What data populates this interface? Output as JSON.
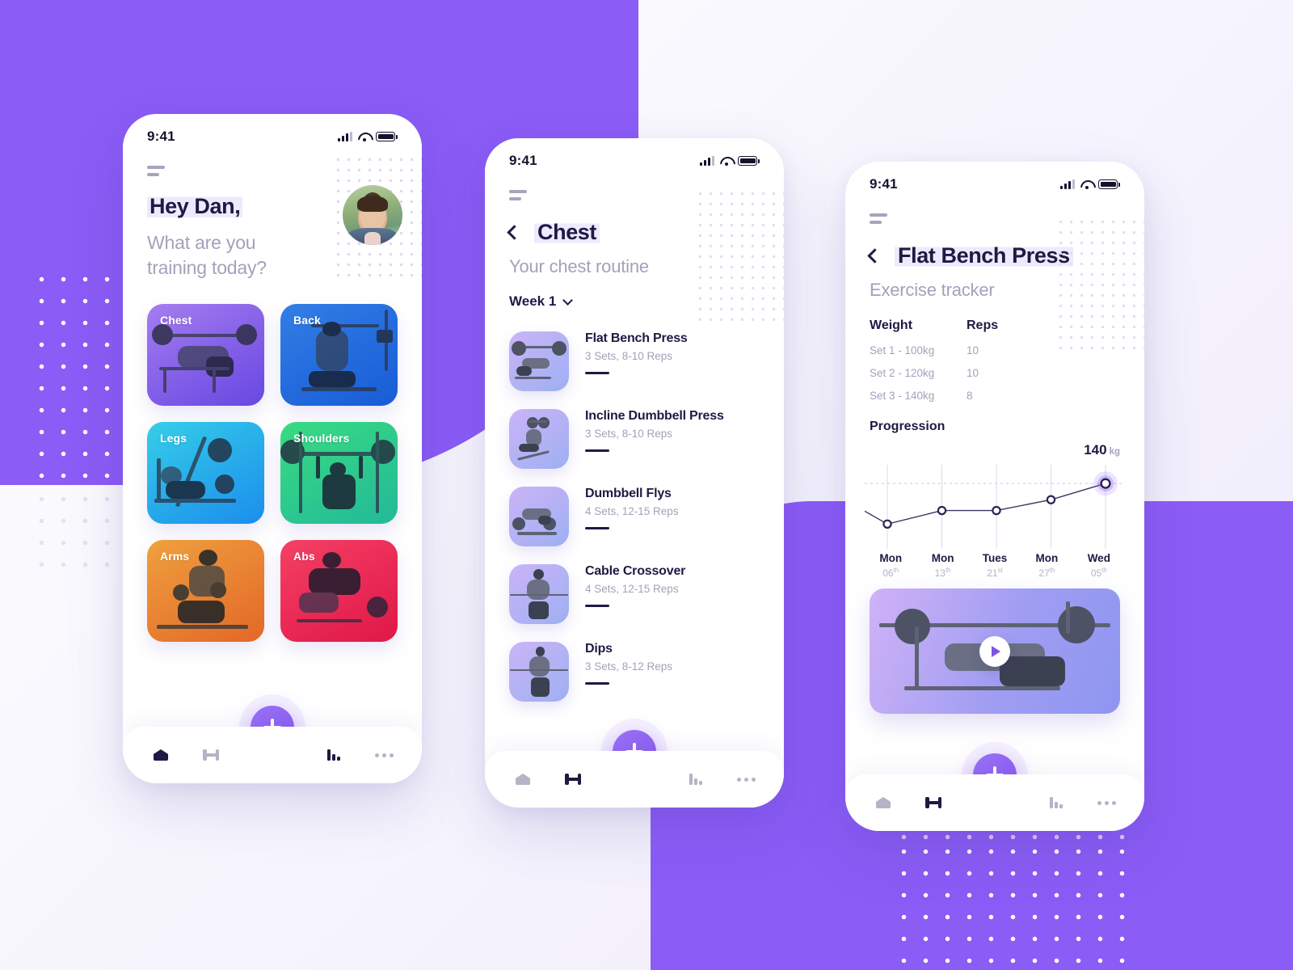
{
  "theme": {
    "accent": "#8b5cf6",
    "ink": "#1d1a43",
    "muted": "#a3a1bb"
  },
  "status_bar": {
    "time": "9:41"
  },
  "home": {
    "greeting": "Hey Dan,",
    "subtitle": "What are you\ntraining today?",
    "categories": [
      {
        "label": "Chest",
        "color_from": "#c6a7f5",
        "color_to": "#9b7ef0"
      },
      {
        "label": "Back",
        "color_from": "#5ea8f0",
        "color_to": "#3f8fe8"
      },
      {
        "label": "Legs",
        "color_from": "#5fe0f0",
        "color_to": "#44b8f5"
      },
      {
        "label": "Shoulders",
        "color_from": "#63e6a8",
        "color_to": "#4fd6c0"
      },
      {
        "label": "Arms",
        "color_from": "#f5c06a",
        "color_to": "#f09a55"
      },
      {
        "label": "Abs",
        "color_from": "#f96a8f",
        "color_to": "#ee3f7c"
      }
    ]
  },
  "routine": {
    "title": "Chest",
    "subtitle": "Your chest routine",
    "week_label": "Week 1",
    "exercises": [
      {
        "name": "Flat Bench Press",
        "meta": "3 Sets, 8-10 Reps"
      },
      {
        "name": "Incline Dumbbell Press",
        "meta": "3 Sets, 8-10 Reps"
      },
      {
        "name": "Dumbbell Flys",
        "meta": "4 Sets, 12-15 Reps"
      },
      {
        "name": "Cable Crossover",
        "meta": "4 Sets, 12-15 Reps"
      },
      {
        "name": "Dips",
        "meta": "3 Sets, 8-12 Reps"
      }
    ]
  },
  "tracker": {
    "title": "Flat Bench Press",
    "subtitle": "Exercise tracker",
    "table": {
      "headers": [
        "Weight",
        "Reps"
      ],
      "rows": [
        {
          "weight": "Set 1 - 100kg",
          "reps": "10"
        },
        {
          "weight": "Set 2 - 120kg",
          "reps": "10"
        },
        {
          "weight": "Set 3 - 140kg",
          "reps": "8"
        }
      ]
    },
    "progression_label": "Progression",
    "highlight_value": "140",
    "highlight_unit": "kg"
  },
  "chart_data": {
    "type": "line",
    "title": "Progression",
    "ylabel": "kg",
    "x": [
      "Mon 06th",
      "Mon 13th",
      "Tues 21st",
      "Mon 27th",
      "Wed 05th"
    ],
    "tick_days": [
      "Mon",
      "Mon",
      "Tues",
      "Mon",
      "Wed"
    ],
    "tick_dates": [
      "06",
      "13",
      "21",
      "27",
      "05"
    ],
    "tick_suffix": [
      "th",
      "th",
      "st",
      "th",
      "th"
    ],
    "values": [
      95,
      110,
      110,
      122,
      140
    ],
    "ylim": [
      80,
      150
    ],
    "grid": "vertical",
    "annotation": "140 kg",
    "highlight_index": 4,
    "legend": "none"
  },
  "nav": {
    "items": [
      {
        "icon": "home-icon",
        "name": "home"
      },
      {
        "icon": "dumbbell-icon",
        "name": "workouts"
      },
      {
        "icon": "chart-icon",
        "name": "stats"
      },
      {
        "icon": "more-icon",
        "name": "more"
      }
    ],
    "fab_label": "+",
    "active_home": 0,
    "active_workouts": 1
  }
}
